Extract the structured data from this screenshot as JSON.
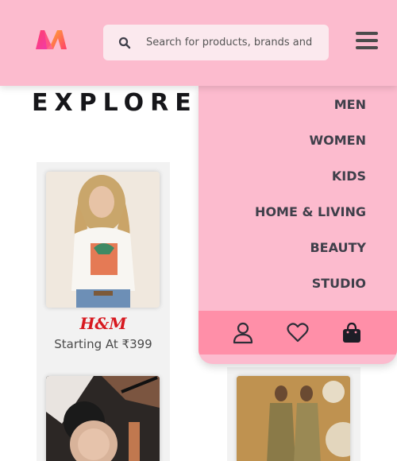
{
  "header": {
    "logo_icon": "myntra-logo-icon",
    "search": {
      "placeholder": "Search for products, brands and more",
      "value": ""
    },
    "menu_icon": "hamburger-icon"
  },
  "main": {
    "heading": "EXPLORE TOP BRANDS",
    "cards": [
      {
        "brand": "H&M",
        "price_text": "Starting At ₹399",
        "brand_color": "#d71920"
      }
    ]
  },
  "menu": {
    "items": [
      "MEN",
      "WOMEN",
      "KIDS",
      "HOME & LIVING",
      "BEAUTY",
      "STUDIO"
    ],
    "footer_icons": [
      "user-icon",
      "heart-icon",
      "shopping-bag-icon"
    ]
  },
  "colors": {
    "header_bg": "#fcbbce",
    "menu_footer_bg": "#ff8fa8",
    "brand_red": "#d71920"
  }
}
